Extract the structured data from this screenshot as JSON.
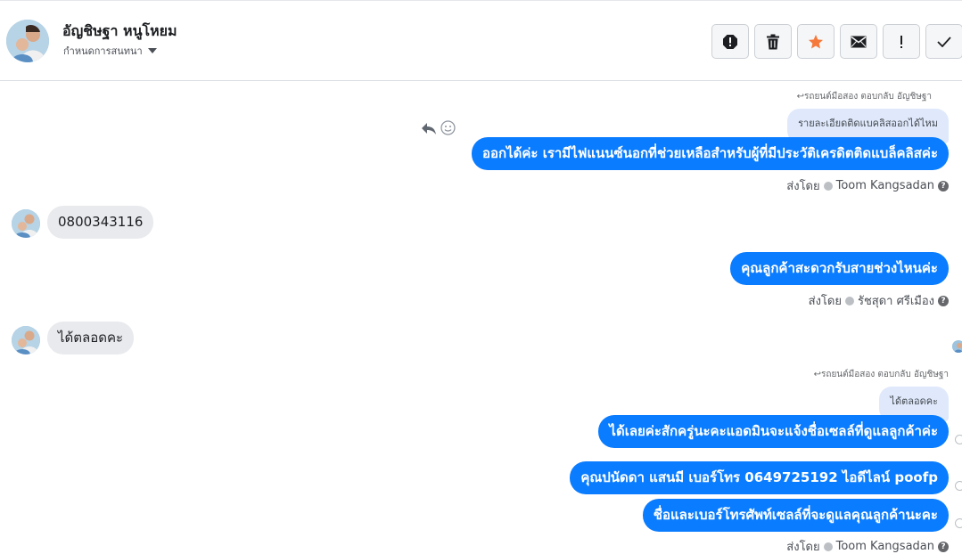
{
  "header": {
    "contact_name": "อัญชิษฐา หนูโหยม",
    "assign_label": "กำหนดการสนทนา"
  },
  "toolbar": {
    "buttons": [
      "spam-icon",
      "trash-icon",
      "star-icon",
      "mail-icon",
      "follow-up-icon",
      "done-icon"
    ],
    "star_color": "#f5793b"
  },
  "messages": [
    {
      "reply_meta": "รถยนต์มือสอง ตอบกลับ อัญชิษฐา",
      "quoted": "รายละเอียดติดแบคลิสออกได้ไหม",
      "text": "ออกได้ค่ะ เรามีไฟแนนซ์นอกที่ช่วยเหลือสำหรับผู้ที่มีประวัติเครดิตติดแบล็คลิสค่ะ",
      "sent_by_label": "ส่งโดย",
      "sender": "Toom Kangsadan"
    },
    {
      "incoming": "0800343116"
    },
    {
      "text": "คุณลูกค้าสะดวกรับสายช่วงไหนค่ะ",
      "sent_by_label": "ส่งโดย",
      "sender": "รัชสุดา ศรีเมือง"
    },
    {
      "incoming": "ได้ตลอดคะ"
    },
    {
      "reply_meta": "รถยนต์มือสอง ตอบกลับ อัญชิษฐา",
      "quoted": "ได้ตลอดคะ",
      "lines": [
        "ได้เลยค่ะสักครู่นะคะแอดมินจะแจ้งชื่อเซลล์ที่ดูแลลูกค้าค่ะ",
        "คุณปนัดดา แสนมี   เบอร์โทร 0649725192  ไอดีไลน์ poofp",
        "ชื่อและเบอร์โทรศัพท์เซลล์ที่จะดูแลคุณลูกค้านะคะ"
      ],
      "sent_by_label": "ส่งโดย",
      "sender": "Toom Kangsadan"
    }
  ],
  "colors": {
    "bubble_out": "#0a7cff",
    "bubble_in": "#e9eaed",
    "quoted_bg": "#dfe9fb"
  }
}
